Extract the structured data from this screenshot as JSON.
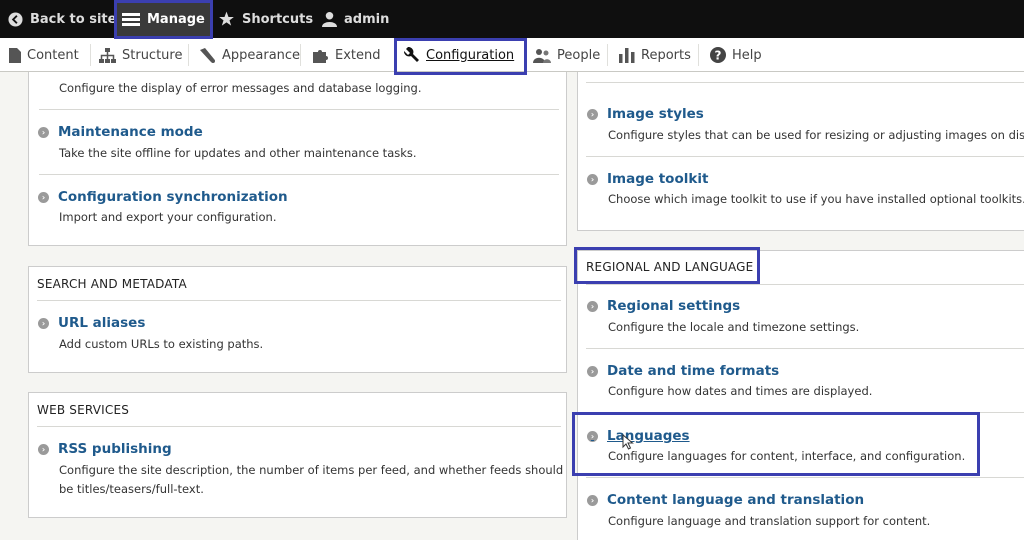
{
  "toolbar": {
    "back_label": "Back to site",
    "manage_label": "Manage",
    "shortcuts_label": "Shortcuts",
    "user_label": "admin"
  },
  "menu": {
    "content": "Content",
    "structure": "Structure",
    "appearance": "Appearance",
    "extend": "Extend",
    "configuration": "Configuration",
    "people": "People",
    "reports": "Reports",
    "help": "Help"
  },
  "left": {
    "development": {
      "items": [
        {
          "desc": "Configure the display of error messages and database logging."
        },
        {
          "label": "Maintenance mode",
          "desc": "Take the site offline for updates and other maintenance tasks."
        },
        {
          "label": "Configuration synchronization",
          "desc": "Import and export your configuration."
        }
      ]
    },
    "search": {
      "title": "SEARCH AND METADATA",
      "items": [
        {
          "label": "URL aliases",
          "desc": "Add custom URLs to existing paths."
        }
      ]
    },
    "web": {
      "title": "WEB SERVICES",
      "items": [
        {
          "label": "RSS publishing",
          "desc_line1": "Configure the site description, the number of items per feed, and whether feeds should",
          "desc_line2": "be titles/teasers/full-text."
        }
      ]
    }
  },
  "right": {
    "media": {
      "items": [
        {
          "label": "Image styles",
          "desc": "Configure styles that can be used for resizing or adjusting images on display."
        },
        {
          "label": "Image toolkit",
          "desc": "Choose which image toolkit to use if you have installed optional toolkits."
        }
      ]
    },
    "regional": {
      "title": "REGIONAL AND LANGUAGE",
      "items": [
        {
          "label": "Regional settings",
          "desc": "Configure the locale and timezone settings."
        },
        {
          "label": "Date and time formats",
          "desc": "Configure how dates and times are displayed."
        },
        {
          "label": "Languages",
          "desc": "Configure languages for content, interface, and configuration."
        },
        {
          "label": "Content language and translation",
          "desc": "Configure language and translation support for content."
        }
      ]
    }
  },
  "colors": {
    "highlight": "#3b3fb0",
    "link": "#1f5a8c",
    "toolbar_bg": "#0f0f0f"
  }
}
